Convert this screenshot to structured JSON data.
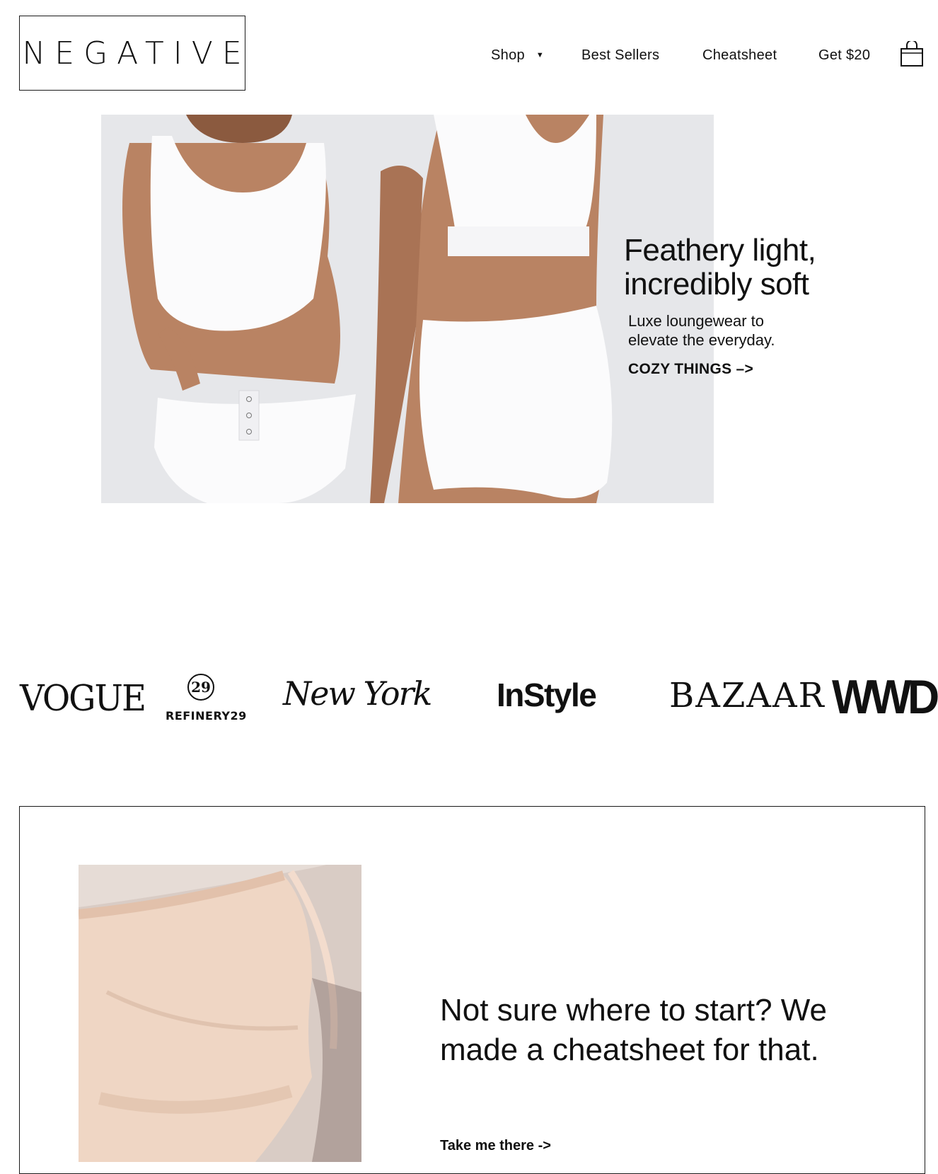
{
  "header": {
    "logo": "NEGATIVE",
    "nav": [
      {
        "label": "Shop",
        "has_dropdown": true
      },
      {
        "label": "Best Sellers"
      },
      {
        "label": "Cheatsheet"
      },
      {
        "label": "Get $20"
      }
    ],
    "cart_icon": "shopping-bag-icon"
  },
  "hero": {
    "title_line1": "Feathery light,",
    "title_line2": "incredibly soft",
    "subtitle_line1": "Luxe loungewear to",
    "subtitle_line2": "elevate the everyday.",
    "cta": "COZY THINGS –>"
  },
  "press": {
    "logos": [
      "VOGUE",
      "REFINERY29",
      "New York",
      "InStyle",
      "BAZAAR",
      "WWD"
    ],
    "refinery29_mark": "29"
  },
  "cheatsheet": {
    "title": "Not sure where to start? We made a cheatsheet for that.",
    "cta": "Take me there ->"
  },
  "colors": {
    "text": "#111111",
    "background": "#ffffff",
    "hero_bg": "#e6e7ea",
    "skin": "#b98363",
    "garment": "#fbfbfc",
    "cheat_bg": "#e6dcd6",
    "bra": "#efd6c4"
  }
}
